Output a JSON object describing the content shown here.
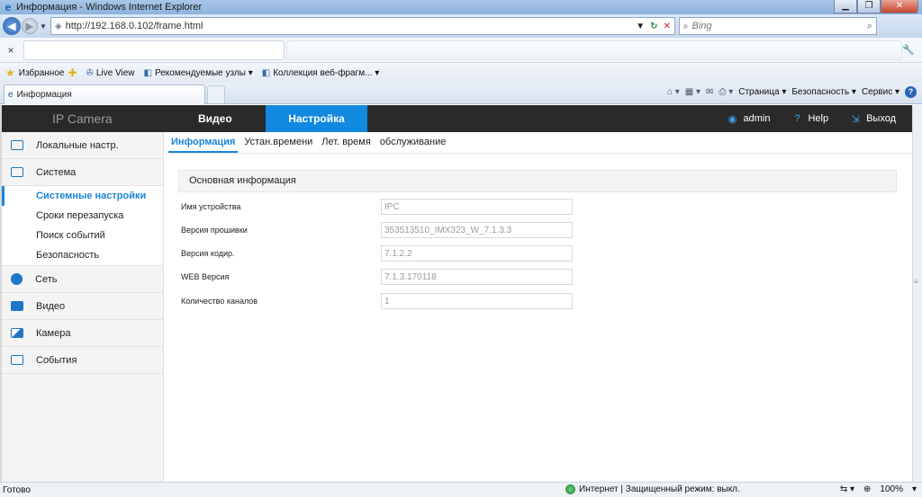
{
  "window": {
    "title": "Информация - Windows Internet Explorer",
    "minimize": "▁",
    "restore": "❐",
    "close": "✕"
  },
  "address": {
    "url": "http://192.168.0.102/frame.html",
    "search_placeholder": "Bing"
  },
  "favorites": {
    "label": "Избранное",
    "items": [
      {
        "label": "Live View"
      },
      {
        "label": "Рекомендуемые узлы ▾"
      },
      {
        "label": "Коллекция веб-фрагм... ▾"
      }
    ]
  },
  "browser_tab": {
    "label": "Информация"
  },
  "command_bar": {
    "page": "Страница ▾",
    "safety": "Безопасность ▾",
    "service": "Сервис ▾"
  },
  "app": {
    "brand": "IP Camera",
    "nav": {
      "video": "Видео",
      "settings": "Настройка"
    },
    "user": "admin",
    "help": "Help",
    "logout": "Выход"
  },
  "sidebar": {
    "items": [
      {
        "label": "Локальные настр."
      },
      {
        "label": "Система"
      },
      {
        "label": "Сеть"
      },
      {
        "label": "Видео"
      },
      {
        "label": "Камера"
      },
      {
        "label": "События"
      }
    ],
    "system_sub": [
      {
        "label": "Системные настройки"
      },
      {
        "label": "Сроки перезапуска"
      },
      {
        "label": "Поиск событий"
      },
      {
        "label": "Безопасность"
      }
    ]
  },
  "subtabs": [
    {
      "label": "Информация"
    },
    {
      "label": "Устан.времени"
    },
    {
      "label": "Лет. время"
    },
    {
      "label": "обслуживание"
    }
  ],
  "info": {
    "section_title": "Основная информация",
    "fields": [
      {
        "label": "Имя устройства",
        "value": "IPC"
      },
      {
        "label": "Версия прошивки",
        "value": "353513510_IMX323_W_7.1.3.3"
      },
      {
        "label": "Версия кодир.",
        "value": "7.1.2.2"
      },
      {
        "label": "WEB Версия",
        "value": "7.1.3.170118"
      },
      {
        "label": "Количество каналов",
        "value": "1"
      }
    ]
  },
  "status": {
    "ready": "Готово",
    "zone": "Интернет | Защищенный режим: выкл.",
    "zoom": "100%"
  }
}
